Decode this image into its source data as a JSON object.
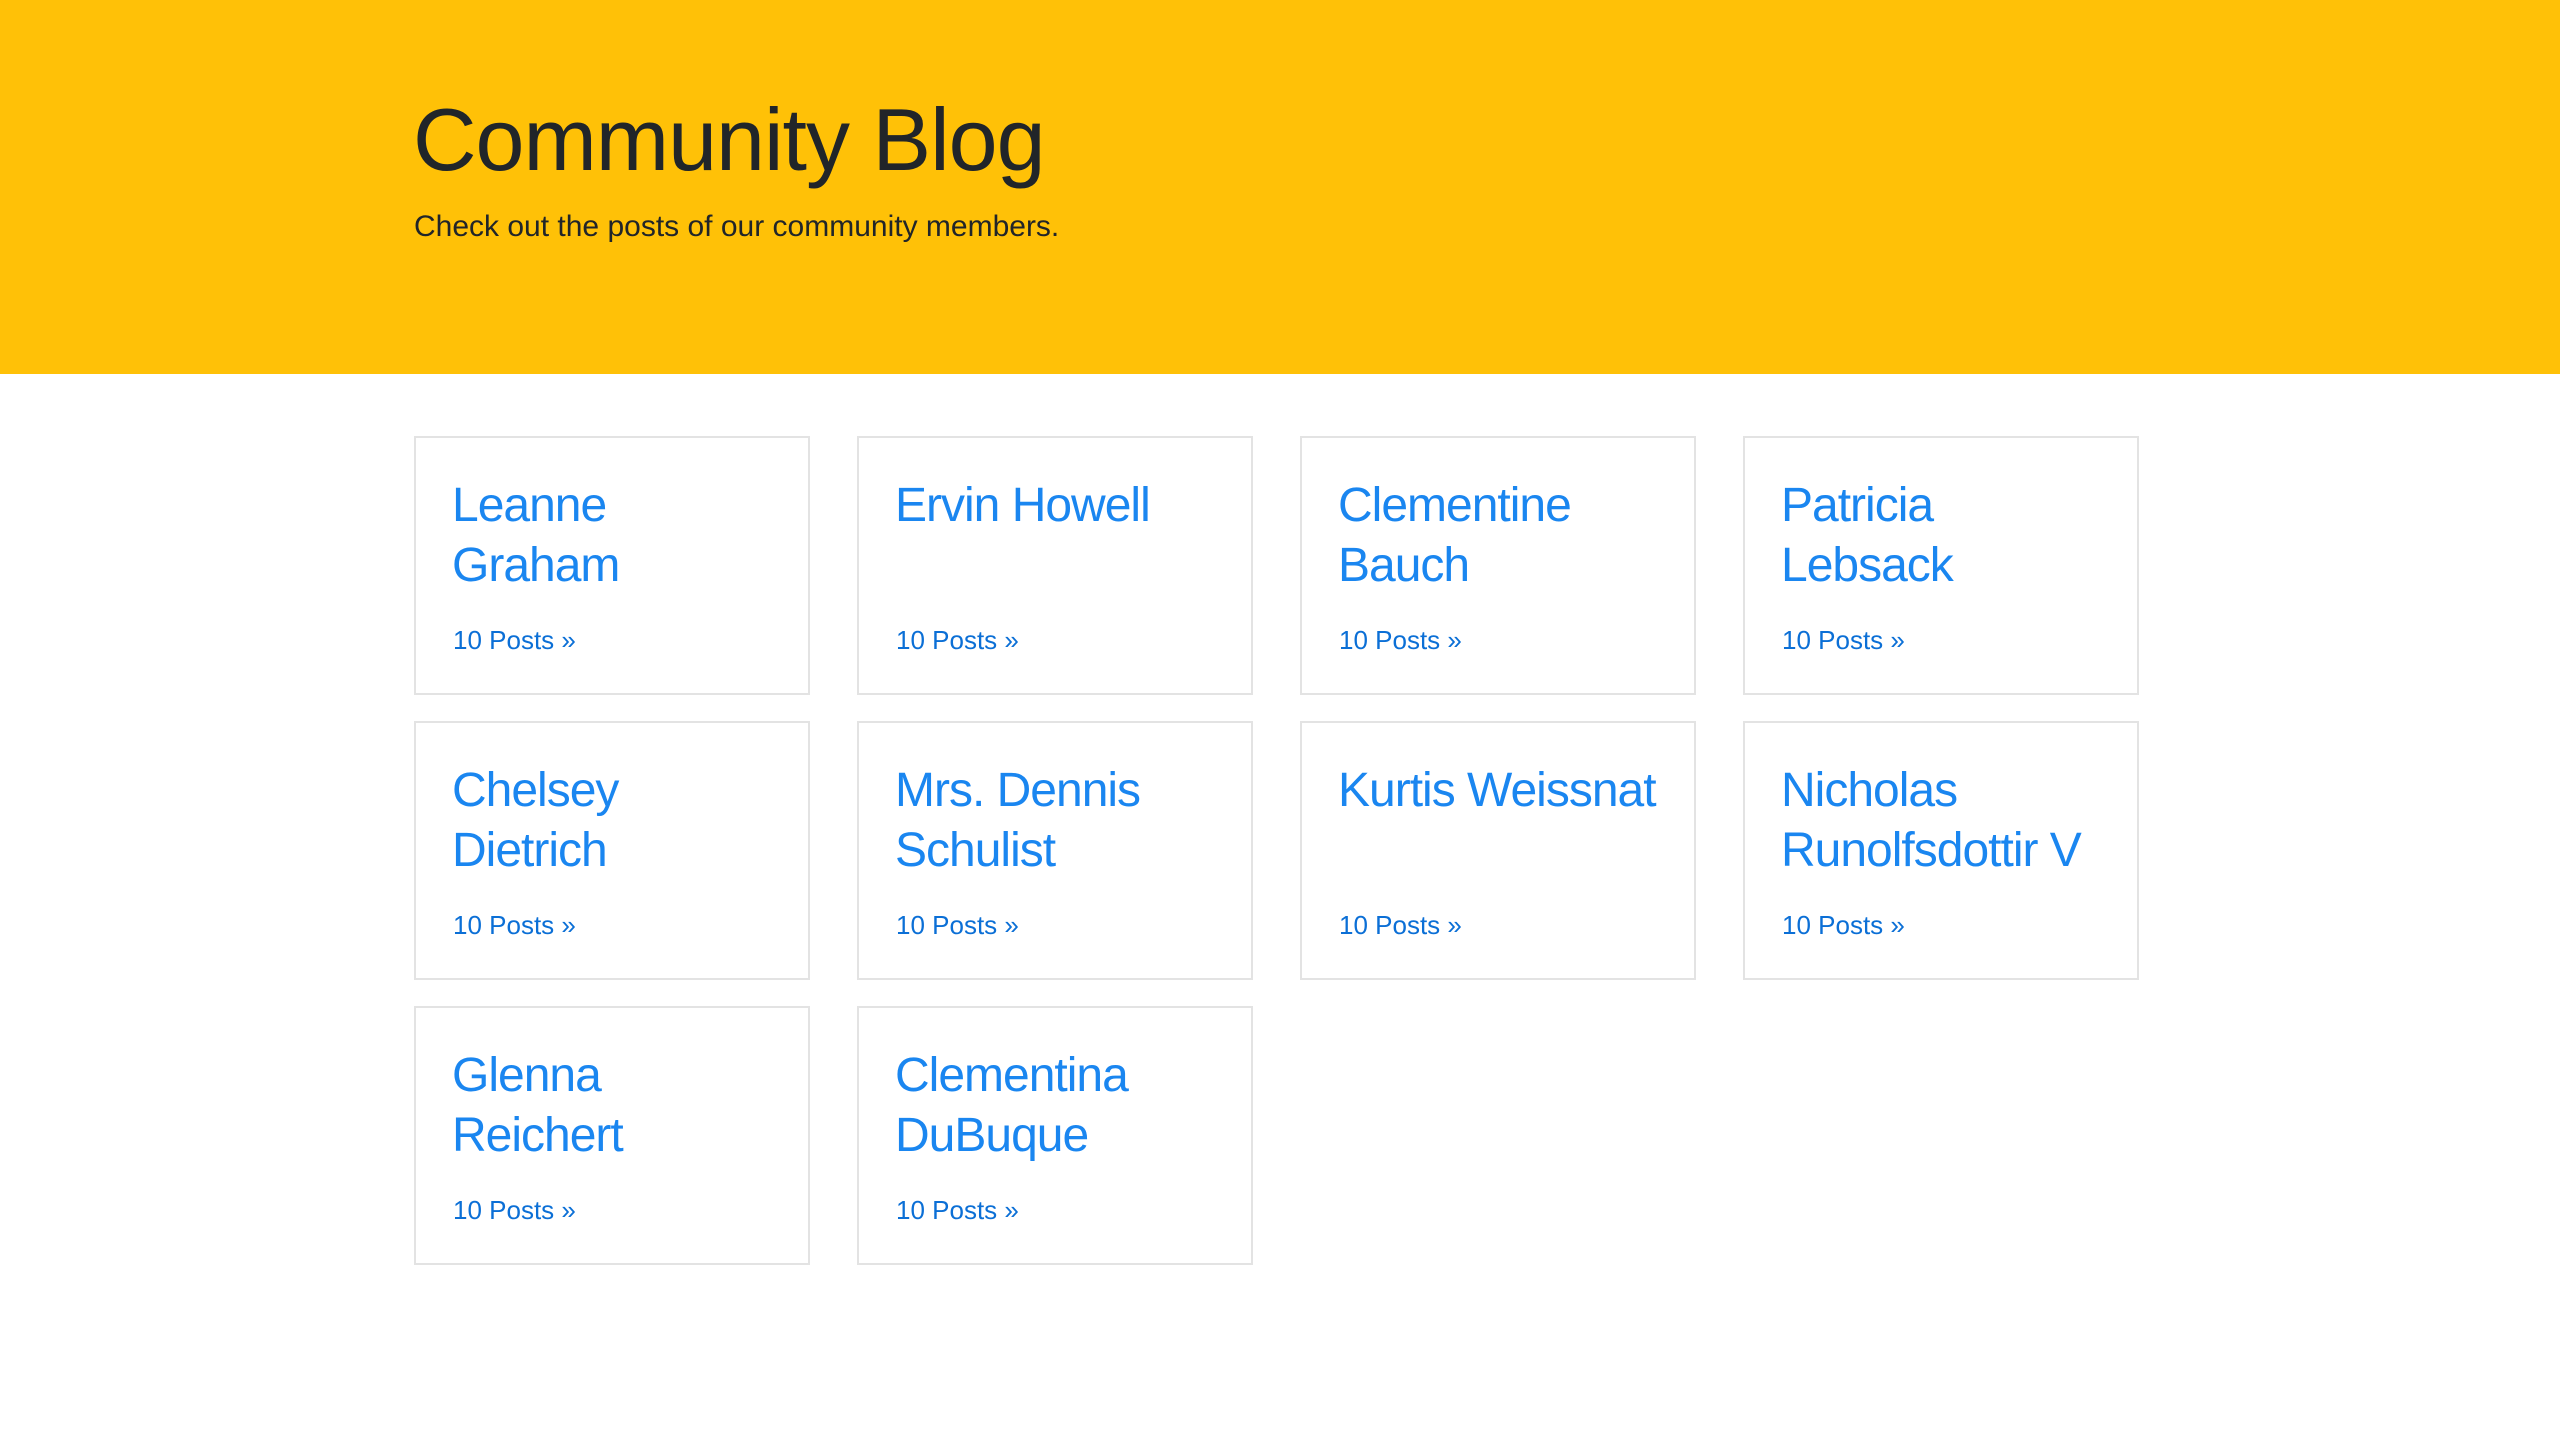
{
  "header": {
    "title": "Community Blog",
    "subtitle": "Check out the posts of our community members."
  },
  "authors": [
    {
      "name": "Leanne Graham",
      "posts_link": "10 Posts »"
    },
    {
      "name": "Ervin Howell",
      "posts_link": "10 Posts »"
    },
    {
      "name": "Clementine Bauch",
      "posts_link": "10 Posts »"
    },
    {
      "name": "Patricia Lebsack",
      "posts_link": "10 Posts »"
    },
    {
      "name": "Chelsey Dietrich",
      "posts_link": "10 Posts »"
    },
    {
      "name": "Mrs. Dennis Schulist",
      "posts_link": "10 Posts »"
    },
    {
      "name": "Kurtis Weissnat",
      "posts_link": "10 Posts »"
    },
    {
      "name": "Nicholas Runolfsdottir V",
      "posts_link": "10 Posts »"
    },
    {
      "name": "Glenna Reichert",
      "posts_link": "10 Posts »"
    },
    {
      "name": "Clementina DuBuque",
      "posts_link": "10 Posts »"
    }
  ],
  "colors": {
    "hero_background": "#ffc107",
    "link": "#1a86f0",
    "text": "#212529"
  }
}
